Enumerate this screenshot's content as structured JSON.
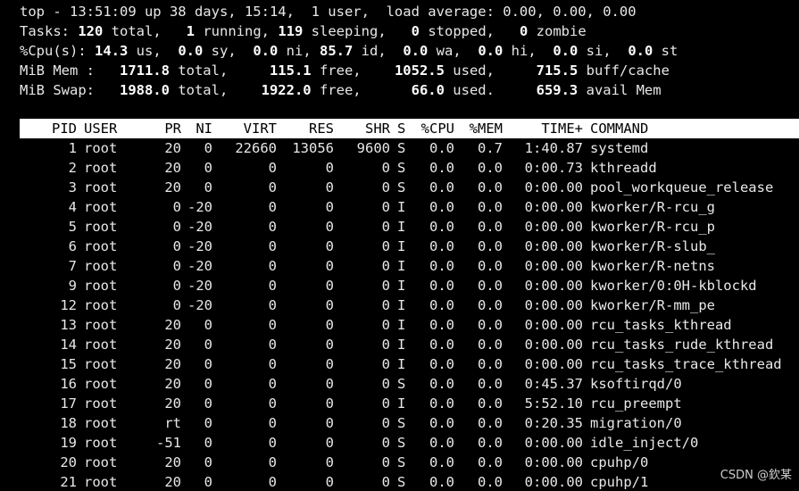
{
  "summary": {
    "line1": "top - 13:51:09 up 38 days, 15:14,  1 user,  load average: 0.00, 0.00, 0.00",
    "tasks": {
      "prefix": "Tasks: ",
      "total": "120",
      "total_l": " total,   ",
      "running": "1",
      "running_l": " running, ",
      "sleeping": "119",
      "sleeping_l": " sleeping,   ",
      "stopped": "0",
      "stopped_l": " stopped,   ",
      "zombie": "0",
      "zombie_l": " zombie"
    },
    "cpu": {
      "prefix": "%Cpu(s): ",
      "us": "14.3",
      "us_l": " us,  ",
      "sy": "0.0",
      "sy_l": " sy,  ",
      "ni": "0.0",
      "ni_l": " ni, ",
      "id": "85.7",
      "id_l": " id,  ",
      "wa": "0.0",
      "wa_l": " wa,  ",
      "hi": "0.0",
      "hi_l": " hi,  ",
      "si": "0.0",
      "si_l": " si,  ",
      "st": "0.0",
      "st_l": " st"
    },
    "mem": {
      "prefix": "MiB Mem :   ",
      "total": "1711.8",
      "total_l": " total,     ",
      "free": "115.1",
      "free_l": " free,    ",
      "used": "1052.5",
      "used_l": " used,     ",
      "cache": "715.5",
      "cache_l": " buff/cache"
    },
    "swap": {
      "prefix": "MiB Swap:   ",
      "total": "1988.0",
      "total_l": " total,    ",
      "free": "1922.0",
      "free_l": " free,      ",
      "used": "66.0",
      "used_l": " used.     ",
      "avail": "659.3",
      "avail_l": " avail Mem"
    }
  },
  "columns": [
    "PID",
    "USER",
    "PR",
    "NI",
    "VIRT",
    "RES",
    "SHR",
    "S",
    "%CPU",
    "%MEM",
    "TIME+",
    "COMMAND"
  ],
  "processes": [
    [
      "1",
      "root",
      "20",
      "0",
      "22660",
      "13056",
      "9600",
      "S",
      "0.0",
      "0.7",
      "1:40.87",
      "systemd"
    ],
    [
      "2",
      "root",
      "20",
      "0",
      "0",
      "0",
      "0",
      "S",
      "0.0",
      "0.0",
      "0:00.73",
      "kthreadd"
    ],
    [
      "3",
      "root",
      "20",
      "0",
      "0",
      "0",
      "0",
      "S",
      "0.0",
      "0.0",
      "0:00.00",
      "pool_workqueue_release"
    ],
    [
      "4",
      "root",
      "0",
      "-20",
      "0",
      "0",
      "0",
      "I",
      "0.0",
      "0.0",
      "0:00.00",
      "kworker/R-rcu_g"
    ],
    [
      "5",
      "root",
      "0",
      "-20",
      "0",
      "0",
      "0",
      "I",
      "0.0",
      "0.0",
      "0:00.00",
      "kworker/R-rcu_p"
    ],
    [
      "6",
      "root",
      "0",
      "-20",
      "0",
      "0",
      "0",
      "I",
      "0.0",
      "0.0",
      "0:00.00",
      "kworker/R-slub_"
    ],
    [
      "7",
      "root",
      "0",
      "-20",
      "0",
      "0",
      "0",
      "I",
      "0.0",
      "0.0",
      "0:00.00",
      "kworker/R-netns"
    ],
    [
      "9",
      "root",
      "0",
      "-20",
      "0",
      "0",
      "0",
      "I",
      "0.0",
      "0.0",
      "0:00.00",
      "kworker/0:0H-kblockd"
    ],
    [
      "12",
      "root",
      "0",
      "-20",
      "0",
      "0",
      "0",
      "I",
      "0.0",
      "0.0",
      "0:00.00",
      "kworker/R-mm_pe"
    ],
    [
      "13",
      "root",
      "20",
      "0",
      "0",
      "0",
      "0",
      "I",
      "0.0",
      "0.0",
      "0:00.00",
      "rcu_tasks_kthread"
    ],
    [
      "14",
      "root",
      "20",
      "0",
      "0",
      "0",
      "0",
      "I",
      "0.0",
      "0.0",
      "0:00.00",
      "rcu_tasks_rude_kthread"
    ],
    [
      "15",
      "root",
      "20",
      "0",
      "0",
      "0",
      "0",
      "I",
      "0.0",
      "0.0",
      "0:00.00",
      "rcu_tasks_trace_kthread"
    ],
    [
      "16",
      "root",
      "20",
      "0",
      "0",
      "0",
      "0",
      "S",
      "0.0",
      "0.0",
      "0:45.37",
      "ksoftirqd/0"
    ],
    [
      "17",
      "root",
      "20",
      "0",
      "0",
      "0",
      "0",
      "I",
      "0.0",
      "0.0",
      "5:52.10",
      "rcu_preempt"
    ],
    [
      "18",
      "root",
      "rt",
      "0",
      "0",
      "0",
      "0",
      "S",
      "0.0",
      "0.0",
      "0:20.35",
      "migration/0"
    ],
    [
      "19",
      "root",
      "-51",
      "0",
      "0",
      "0",
      "0",
      "S",
      "0.0",
      "0.0",
      "0:00.00",
      "idle_inject/0"
    ],
    [
      "20",
      "root",
      "20",
      "0",
      "0",
      "0",
      "0",
      "S",
      "0.0",
      "0.0",
      "0:00.00",
      "cpuhp/0"
    ],
    [
      "21",
      "root",
      "20",
      "0",
      "0",
      "0",
      "0",
      "S",
      "0.0",
      "0.0",
      "0:00.00",
      "cpuhp/1"
    ]
  ],
  "watermark": "CSDN @欽某",
  "colors": {
    "background": "#000000",
    "text": "#e8e8e8",
    "header_bg": "#ffffff",
    "header_text": "#000000"
  }
}
